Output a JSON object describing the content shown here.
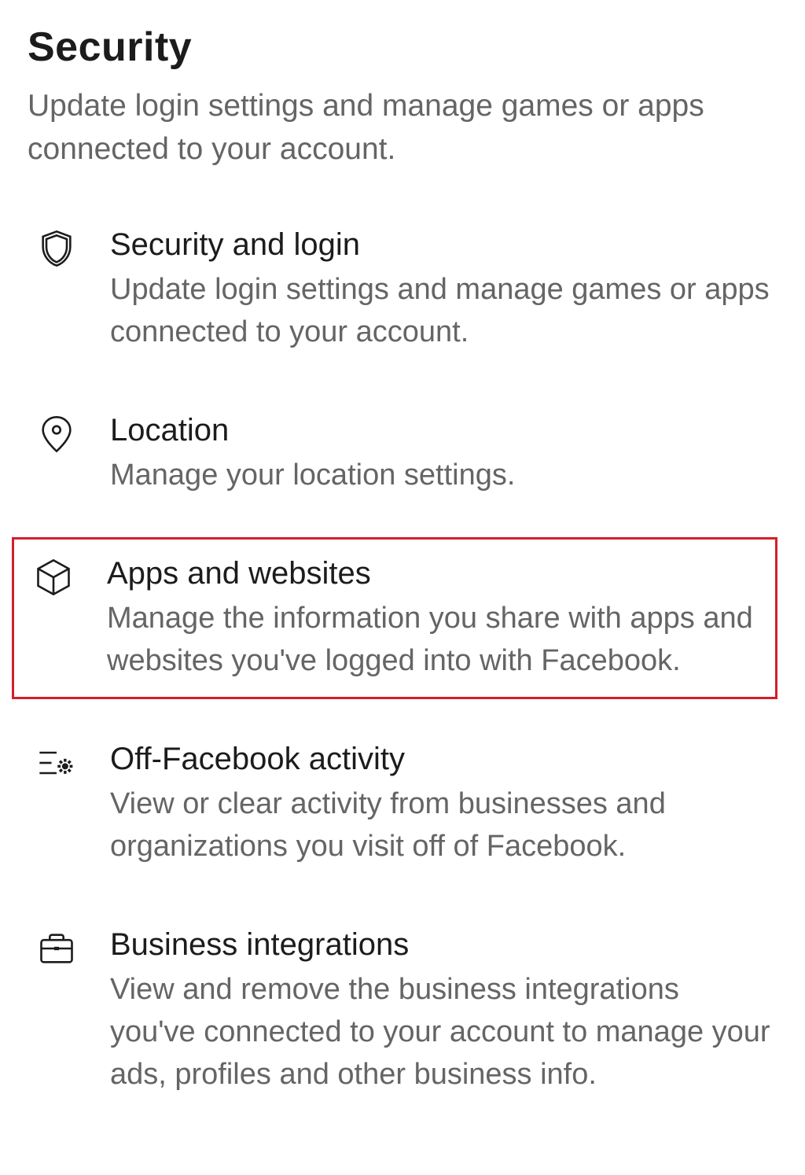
{
  "section": {
    "title": "Security",
    "subtitle": "Update login settings and manage games or apps connected to your account."
  },
  "items": [
    {
      "icon": "shield-icon",
      "title": "Security and login",
      "description": "Update login settings and manage games or apps connected to your account.",
      "highlighted": false
    },
    {
      "icon": "location-pin-icon",
      "title": "Location",
      "description": "Manage your location settings.",
      "highlighted": false
    },
    {
      "icon": "cube-icon",
      "title": "Apps and websites",
      "description": "Manage the information you share with apps and websites you've logged into with Facebook.",
      "highlighted": true
    },
    {
      "icon": "activity-gear-icon",
      "title": "Off-Facebook activity",
      "description": "View or clear activity from businesses and organizations you visit off of Facebook.",
      "highlighted": false
    },
    {
      "icon": "briefcase-icon",
      "title": "Business integrations",
      "description": "View and remove the business integrations you've connected to your account to manage your ads, profiles and other business info.",
      "highlighted": false
    }
  ]
}
